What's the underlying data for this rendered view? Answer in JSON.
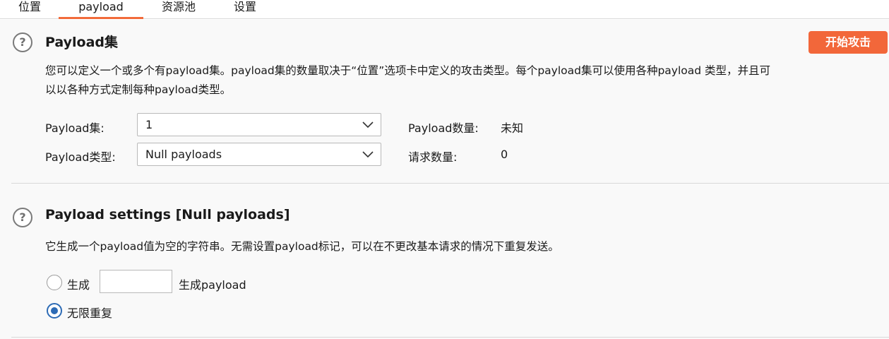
{
  "tabs": [
    {
      "label": "位置",
      "active": false
    },
    {
      "label": "payload",
      "active": true
    },
    {
      "label": "资源池",
      "active": false
    },
    {
      "label": "设置",
      "active": false
    }
  ],
  "payload_sets": {
    "title": "Payload集",
    "description_line1": "您可以定义一个或多个有payload集。payload集的数量取决于“位置”选项卡中定义的攻击类型。每个payload集可以使用各种payload 类型，并且可",
    "description_line2": "以以各种方式定制每种payload类型。",
    "start_attack_label": "开始攻击",
    "set_label": "Payload集:",
    "set_value": "1",
    "type_label": "Payload类型:",
    "type_value": "Null payloads",
    "count_label": "Payload数量:",
    "count_value": "未知",
    "request_label": "请求数量:",
    "request_value": "0"
  },
  "payload_settings": {
    "title": "Payload settings [Null payloads]",
    "description": "它生成一个payload值为空的字符串。无需设置payload标记，可以在不更改基本请求的情况下重复发送。",
    "generate_label": "生成",
    "generate_value": "",
    "generate_suffix": "生成payload",
    "generate_checked": false,
    "infinite_label": "无限重复",
    "infinite_checked": true
  },
  "colors": {
    "accent": "#f26b3a",
    "radio_selected": "#2d6bb5"
  },
  "icons": [
    "help-icon",
    "chevron-down-icon"
  ]
}
